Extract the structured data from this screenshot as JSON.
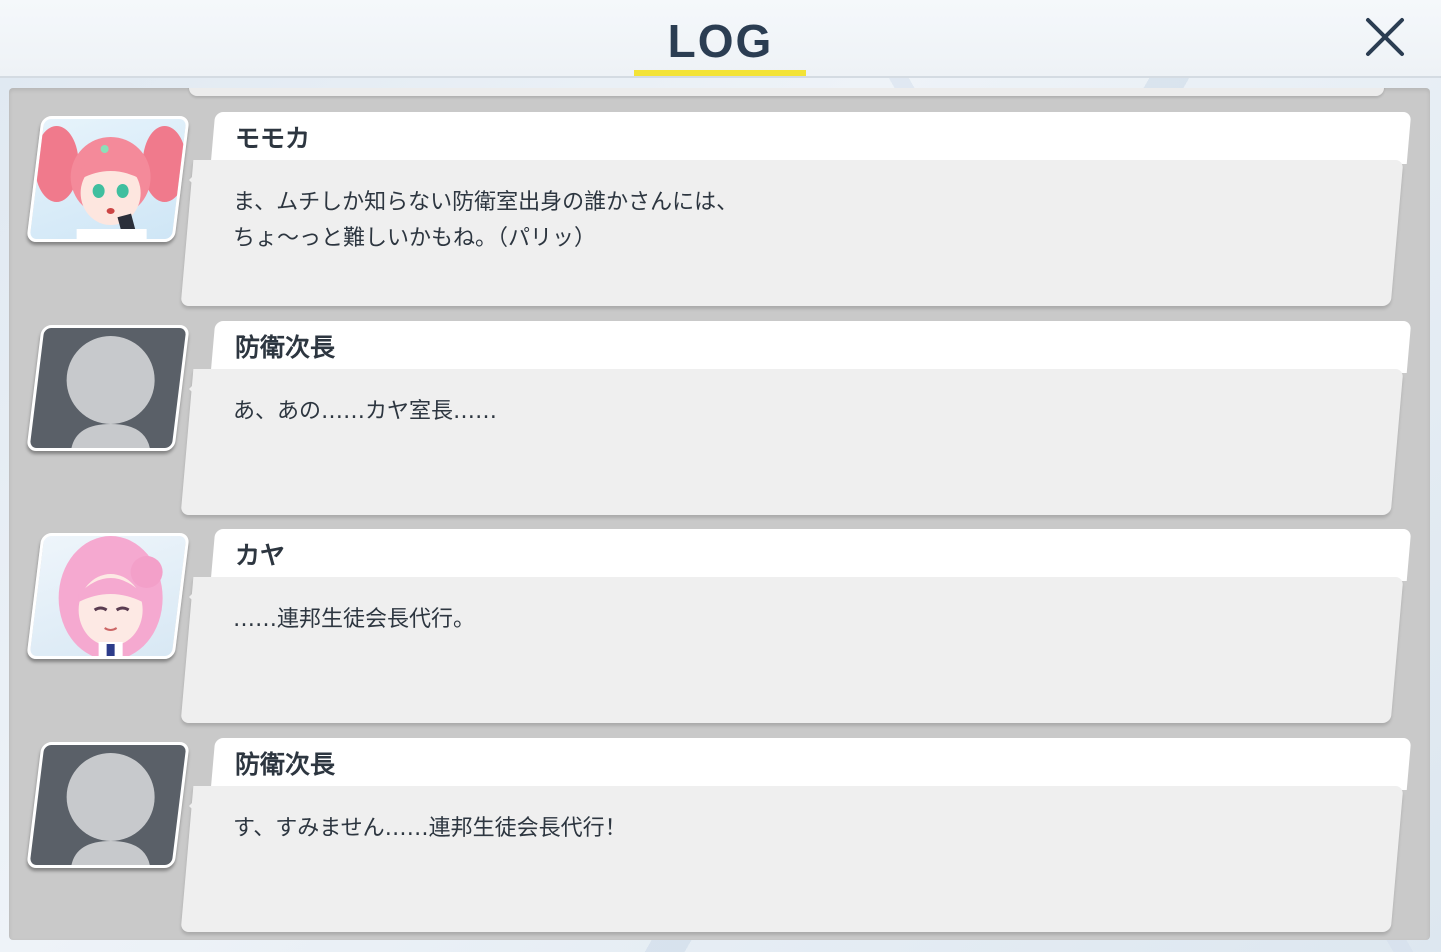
{
  "header": {
    "title": "LOG",
    "close_icon": "close-x-icon",
    "underline_color": "#f3e337"
  },
  "entries": [
    {
      "name": "モモカ",
      "avatar": "momoka-portrait",
      "lines": [
        "ま、ムチしか知らない防衛室出身の誰かさんには、",
        "ちょ～っと難しいかもね。（パリッ）"
      ]
    },
    {
      "name": "防衛次長",
      "avatar": "silhouette-portrait",
      "lines": [
        "あ、あの……カヤ室長……"
      ]
    },
    {
      "name": "カヤ",
      "avatar": "kaya-portrait",
      "lines": [
        "……連邦生徒会長代行。"
      ]
    },
    {
      "name": "防衛次長",
      "avatar": "silhouette-portrait",
      "lines": [
        "す、すみません……連邦生徒会長代行！"
      ]
    }
  ]
}
